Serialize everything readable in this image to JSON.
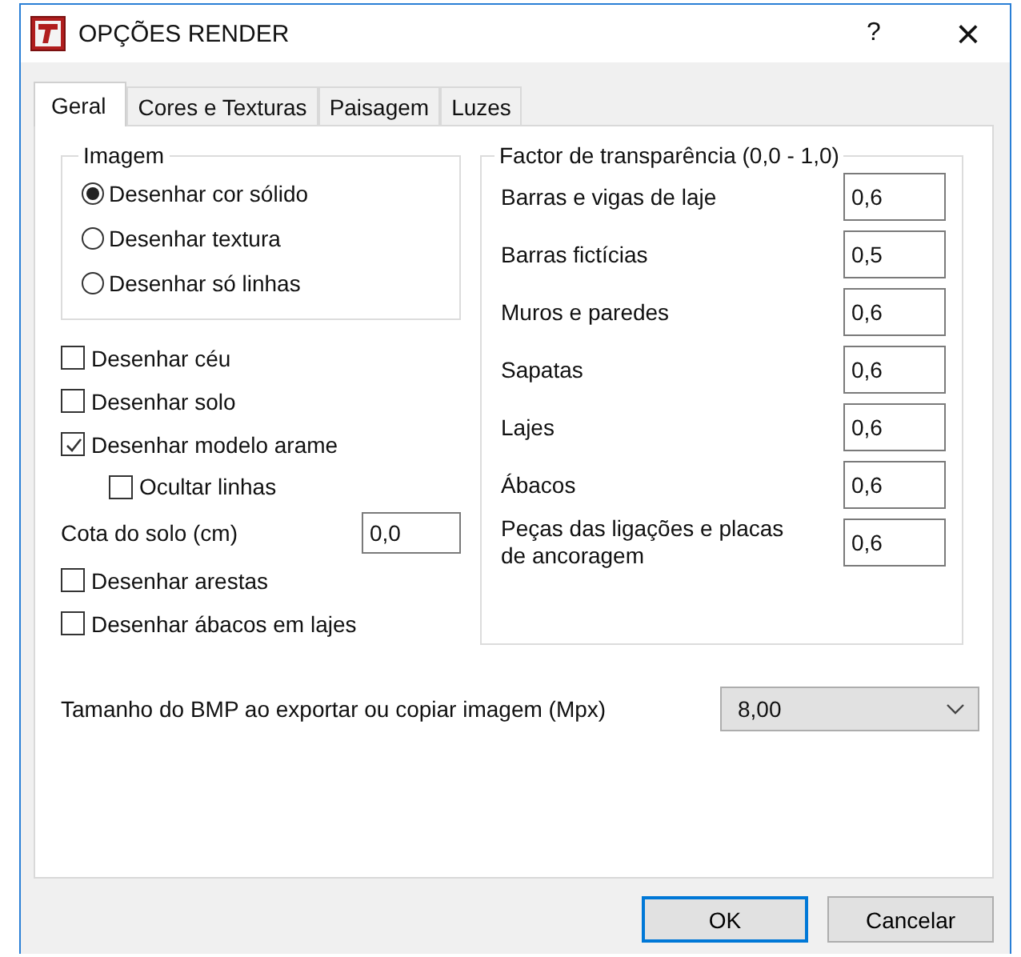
{
  "window": {
    "title": "OPÇÕES RENDER",
    "help": "?",
    "close": "×"
  },
  "tabs": [
    {
      "label": "Geral",
      "selected": true
    },
    {
      "label": "Cores e Texturas",
      "selected": false
    },
    {
      "label": "Paisagem",
      "selected": false
    },
    {
      "label": "Luzes",
      "selected": false
    }
  ],
  "image_group": {
    "title": "Imagem",
    "options": [
      {
        "label": "Desenhar cor sólido",
        "selected": true
      },
      {
        "label": "Desenhar textura",
        "selected": false
      },
      {
        "label": "Desenhar só linhas",
        "selected": false
      }
    ]
  },
  "options": [
    {
      "kind": "checkbox",
      "label": "Desenhar céu",
      "checked": false
    },
    {
      "kind": "checkbox",
      "label": "Desenhar solo",
      "checked": false
    },
    {
      "kind": "checkbox",
      "label": "Desenhar modelo arame",
      "checked": true,
      "children": [
        {
          "kind": "checkbox",
          "label": "Ocultar linhas",
          "checked": false
        }
      ]
    },
    {
      "kind": "field",
      "label": "Cota do solo (cm)",
      "value": "0,0"
    },
    {
      "kind": "checkbox",
      "label": "Desenhar arestas",
      "checked": false
    },
    {
      "kind": "checkbox",
      "label": "Desenhar ábacos em lajes",
      "checked": false
    }
  ],
  "transparency": {
    "title": "Factor de transparência (0,0 - 1,0)",
    "rows": [
      {
        "label": "Barras e vigas de laje",
        "value": "0,6"
      },
      {
        "label": "Barras fictícias",
        "value": "0,5"
      },
      {
        "label": "Muros e paredes",
        "value": "0,6"
      },
      {
        "label": "Sapatas",
        "value": "0,6"
      },
      {
        "label": "Lajes",
        "value": "0,6"
      },
      {
        "label": "Ábacos",
        "value": "0,6"
      },
      {
        "label": "Peças das ligações e placas de ancoragem",
        "value": "0,6"
      }
    ]
  },
  "bmp_size": {
    "label": "Tamanho do BMP ao exportar ou copiar imagem (Mpx)",
    "value": "8,00"
  },
  "buttons": [
    {
      "label": "OK",
      "default": true
    },
    {
      "label": "Cancelar",
      "default": false
    }
  ]
}
